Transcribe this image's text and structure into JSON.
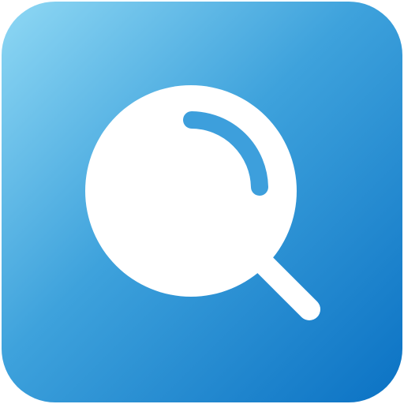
{
  "icon": {
    "name": "magnifying-glass-icon",
    "colors": {
      "gradient_start": "#8fd8f4",
      "gradient_mid": "#3ea2dc",
      "gradient_end": "#0b72c4",
      "glyph": "#ffffff",
      "highlight": "#3d9fdc"
    }
  }
}
